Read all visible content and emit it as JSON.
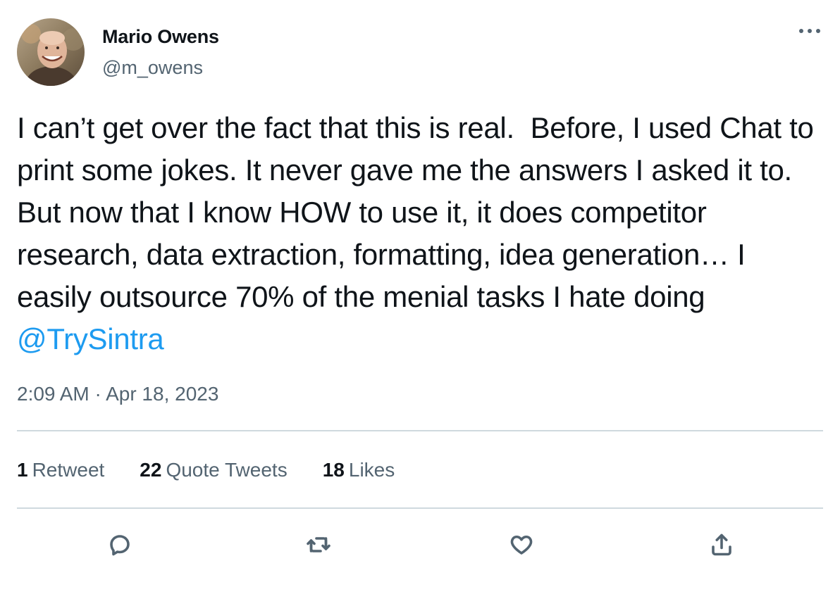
{
  "author": {
    "display_name": "Mario Owens",
    "handle": "@m_owens",
    "avatar_icon": "profile-photo"
  },
  "tweet": {
    "text": "I can’t get over the fact that this is real.  Before, I used Chat to print some jokes. It never gave me the answers I asked it to. But now that I know HOW to use it, it does competitor research, data extraction, formatting, idea generation… I easily outsource 70% of the menial tasks I hate doing ",
    "mention": "@TrySintra",
    "time": "2:09 AM",
    "separator": "·",
    "date": "Apr 18, 2023"
  },
  "stats": {
    "retweets_count": "1",
    "retweets_label": "Retweet",
    "quotes_count": "22",
    "quotes_label": "Quote Tweets",
    "likes_count": "18",
    "likes_label": "Likes"
  },
  "actions": {
    "reply_icon": "reply-icon",
    "retweet_icon": "retweet-icon",
    "like_icon": "heart-icon",
    "share_icon": "share-icon",
    "more_icon": "more-icon"
  },
  "colors": {
    "text_primary": "#0f1419",
    "text_secondary": "#536471",
    "link": "#1d9bf0",
    "divider": "#cfd9de"
  }
}
